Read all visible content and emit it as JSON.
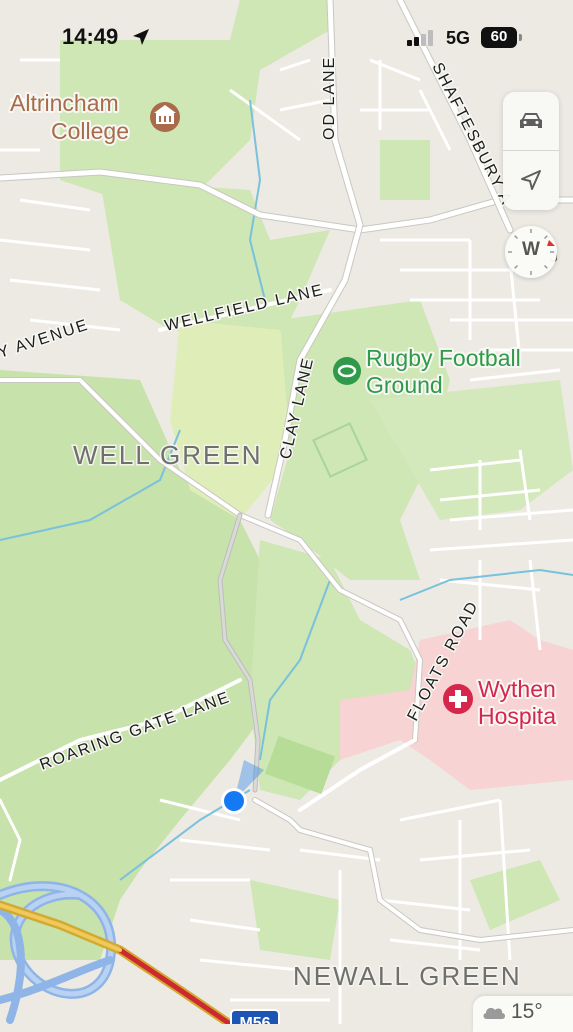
{
  "status_bar": {
    "time": "14:49",
    "network": "5G",
    "battery": "60"
  },
  "map": {
    "pois": [
      {
        "line1": "Altrincham",
        "line2": "College",
        "icon": "school-icon"
      },
      {
        "line1": "Rugby Football",
        "line2": "Ground",
        "icon": "stadium-icon"
      },
      {
        "line1": "Wythen",
        "line2": "Hospita",
        "icon": "hospital-icon"
      }
    ],
    "roads": [
      "OD LANE",
      "SHAFTESBURY A",
      "WELLFIELD LANE",
      "Y AVENUE",
      "CLAY LANE",
      "FLOATS ROAD",
      "ROARING GATE LANE"
    ],
    "areas": [
      "WELL GREEN",
      "NEWALL GREEN"
    ],
    "motorway_shield": "M56"
  },
  "controls": {
    "compass_heading": "W"
  },
  "weather": {
    "temperature": "15°",
    "icon": "cloud-icon"
  },
  "colors": {
    "park": "#cfe6b5",
    "land": "#eceae3",
    "road": "#ffffff",
    "water": "#79c1dc",
    "motorway": "#8fb4e8",
    "user_location": "#1479f2",
    "hospital_area": "#f7d3d3",
    "hospital_text": "#d7264c",
    "poi_green_text": "#2f9a4a",
    "school_brown": "#a86c4b"
  }
}
